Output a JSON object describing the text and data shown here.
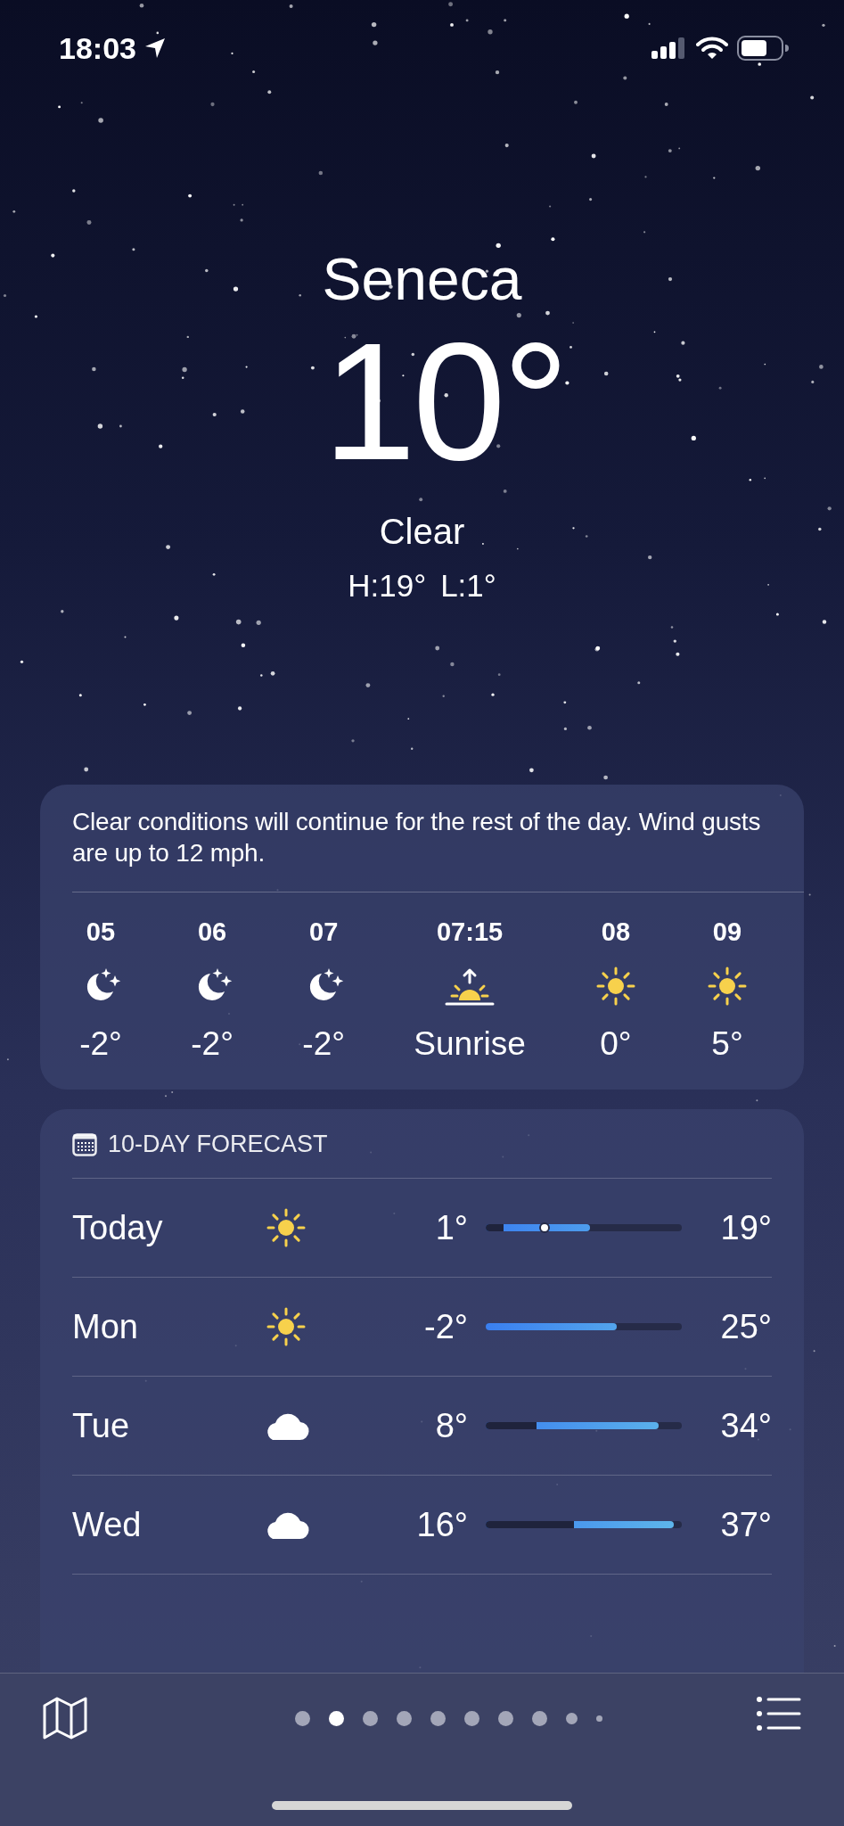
{
  "status_bar": {
    "time": "18:03"
  },
  "current": {
    "city": "Seneca",
    "temperature": "10°",
    "condition": "Clear",
    "high": "H:19°",
    "low": "L:1°"
  },
  "hourly": {
    "summary": "Clear conditions will continue for the rest of the day. Wind gusts are up to 12 mph.",
    "hours": [
      {
        "time": "05",
        "kind": "moon_stars",
        "temp": "-2°"
      },
      {
        "time": "06",
        "kind": "moon_stars",
        "temp": "-2°"
      },
      {
        "time": "07",
        "kind": "moon_stars",
        "temp": "-2°"
      },
      {
        "time": "07:15",
        "kind": "sunrise",
        "temp": "Sunrise"
      },
      {
        "time": "08",
        "kind": "sun",
        "temp": "0°"
      },
      {
        "time": "09",
        "kind": "sun",
        "temp": "5°"
      }
    ]
  },
  "forecast": {
    "title": "10-DAY FORECAST",
    "days": [
      {
        "day": "Today",
        "kind": "sun",
        "low": "1°",
        "high": "19°",
        "range": {
          "from": {
            "level": 0.09
          },
          "to": {
            "level": 0.53
          }
        },
        "current": {
          "level": 0.3
        }
      },
      {
        "day": "Mon",
        "kind": "sun",
        "low": "-2°",
        "high": "25°",
        "range": {
          "to": {
            "level": 0.67
          }
        }
      },
      {
        "day": "Tue",
        "kind": "cloud",
        "low": "8°",
        "high": "34°",
        "range": {
          "from": {
            "level": 0.26
          },
          "to": {
            "level": 0.88
          }
        }
      },
      {
        "day": "Wed",
        "kind": "cloud",
        "low": "16°",
        "high": "37°",
        "range": {
          "from": {
            "level": 0.45
          },
          "to": {
            "level": 0.96
          }
        }
      }
    ]
  },
  "page_dots": [
    {
      "kind": "full",
      "selected": false
    },
    {
      "kind": "full",
      "selected": true
    },
    {
      "kind": "full",
      "selected": false
    },
    {
      "kind": "full",
      "selected": false
    },
    {
      "kind": "full",
      "selected": false
    },
    {
      "kind": "full",
      "selected": false
    },
    {
      "kind": "full",
      "selected": false
    },
    {
      "kind": "full",
      "selected": false
    },
    {
      "kind": "small",
      "selected": false
    },
    {
      "kind": "tiny",
      "selected": false
    }
  ]
}
